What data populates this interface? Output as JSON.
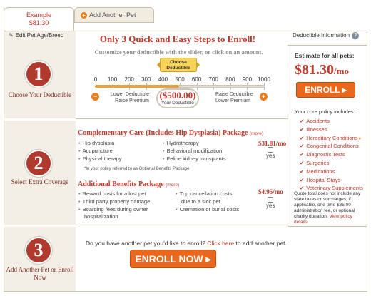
{
  "tabs": {
    "active": {
      "line1": "Example",
      "line2": "$81.30"
    },
    "inactive": {
      "label": "Add Another Pet"
    }
  },
  "sidebar": {
    "edit_link": "Edit Pet Age/Breed",
    "steps": [
      {
        "number": "1",
        "label": "Choose Your Deductible"
      },
      {
        "number": "2",
        "label": "Select Extra Coverage"
      },
      {
        "number": "3",
        "label": "Add Another Pet or Enroll Now"
      }
    ]
  },
  "step1": {
    "title": "Only 3 Quick and Easy Steps to Enroll!",
    "deductible_info": "Deductible Information",
    "subtitle": "Customize your deductible with the slider, or click on an amount.",
    "slider": {
      "badge": "Choose Deductible",
      "ticks": [
        "0",
        "100",
        "200",
        "300",
        "400",
        "500",
        "600",
        "700",
        "800",
        "900",
        "1000"
      ],
      "value_fraction": 0.5,
      "lower_text": "Lower Deductible",
      "raise_premium": "Raise Premium",
      "raise_deductible": "Raise Deductible",
      "lower_premium": "Lower Premium",
      "amount": "($500.00)",
      "amount_caption": "Your Deductible"
    }
  },
  "estimate": {
    "title": "Estimate for all pets:",
    "price": "$81.30",
    "per": "/mo",
    "enroll_label": "ENROLL",
    "core_title": "Your core policy includes:",
    "core_items": [
      "Accidents",
      "Illnesses",
      "Hereditary Conditions",
      "Congenital Conditions",
      "Diagnostic Tests",
      "Surgeries",
      "Medications",
      "Hospital Stays",
      "Veterinary Supplements"
    ],
    "note": "Quote total does not include any state taxes or surcharges, if applicable, one-time $35.00 administration fee, or optional charity donation.",
    "note_link": "View policy details."
  },
  "step2": {
    "comp": {
      "title": "Complementary Care (Includes Hip Dysplasia) Package",
      "more": "(more)",
      "price": "$31.81/mo",
      "yes": "yes",
      "benefits": [
        "Hip dysplasia",
        "Acupuncture",
        "Physical therapy",
        "Hydrotherapy",
        "Behavioral modification",
        "Feline kidney transplants"
      ],
      "note": "*In your policy referred to as Optional Benefits Package"
    },
    "additional": {
      "title": "Additional Benefits Package",
      "more": "(more)",
      "price": "$4.95/mo",
      "yes": "yes",
      "benefits": [
        "Reward costs for a lost pet",
        "Third party property damage",
        "Boarding fees during owner",
        "hospitalization",
        "Trip cancellation costs",
        "due to a sick pet",
        "Cremation or burial costs"
      ]
    }
  },
  "step3": {
    "question": "Do you have another pet you'd like to enroll?",
    "link": "Click here",
    "suffix": "to add another pet.",
    "enroll_now": "ENROLL NOW"
  }
}
